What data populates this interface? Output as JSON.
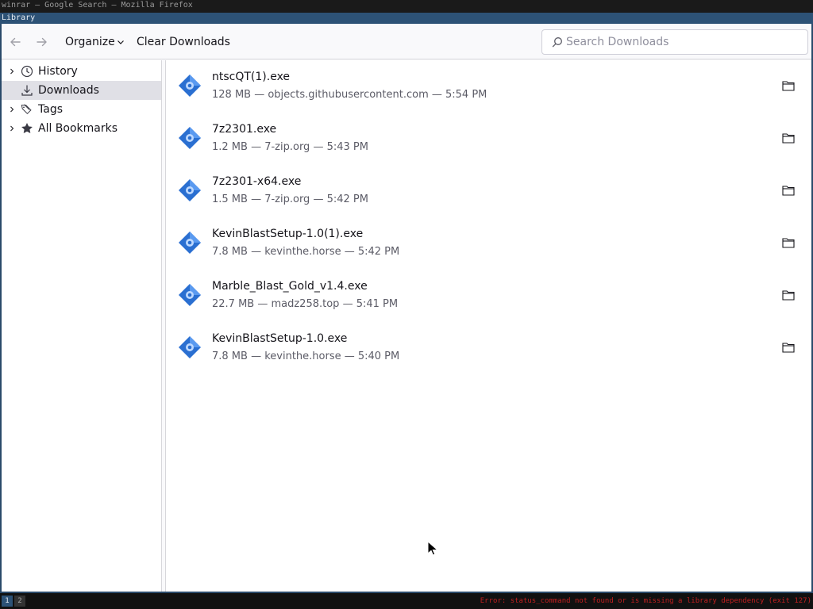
{
  "system": {
    "top_title": "winrar — Google Search — Mozilla Firefox",
    "workspaces": [
      "1",
      "2"
    ],
    "status_error": "Error: status_command not found or is missing a library dependency (exit 127)"
  },
  "window": {
    "title": "Library"
  },
  "toolbar": {
    "back_icon": "arrow-left-icon",
    "forward_icon": "arrow-right-icon",
    "organize_label": "Organize",
    "clear_label": "Clear Downloads",
    "search_placeholder": "Search Downloads",
    "search_value": ""
  },
  "sidebar": {
    "items": [
      {
        "label": "History",
        "icon": "clock-icon",
        "expandable": true,
        "selected": false
      },
      {
        "label": "Downloads",
        "icon": "download-icon",
        "expandable": false,
        "selected": true
      },
      {
        "label": "Tags",
        "icon": "tag-icon",
        "expandable": true,
        "selected": false
      },
      {
        "label": "All Bookmarks",
        "icon": "star-icon",
        "expandable": true,
        "selected": false
      }
    ]
  },
  "downloads": [
    {
      "name": "ntscQT(1).exe",
      "meta": "128 MB — objects.githubusercontent.com — 5:54 PM"
    },
    {
      "name": "7z2301.exe",
      "meta": "1.2 MB — 7-zip.org — 5:43 PM"
    },
    {
      "name": "7z2301-x64.exe",
      "meta": "1.5 MB — 7-zip.org — 5:42 PM"
    },
    {
      "name": "KevinBlastSetup-1.0(1).exe",
      "meta": "7.8 MB — kevinthe.horse — 5:42 PM"
    },
    {
      "name": "Marble_Blast_Gold_v1.4.exe",
      "meta": "22.7 MB — madz258.top — 5:41 PM"
    },
    {
      "name": "KevinBlastSetup-1.0.exe",
      "meta": "7.8 MB — kevinthe.horse — 5:40 PM"
    }
  ],
  "colors": {
    "accent": "#2d5276",
    "selected_row": "#e0e0e6",
    "exe_icon": "#2a6fd1"
  }
}
